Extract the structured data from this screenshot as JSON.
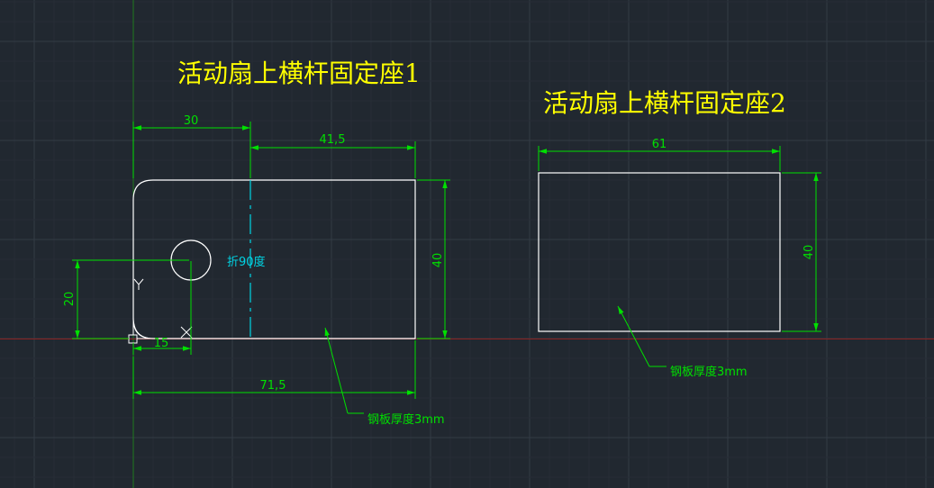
{
  "drawing": {
    "colors": {
      "background": "#212830",
      "grid_minor": "#262d36",
      "grid_major": "#333b45",
      "geometry": "#ffffff",
      "dimension": "#00e000",
      "title": "#ffff00",
      "fold_line": "#00d5e5",
      "axis_y": "#1e7a1e",
      "axis_x": "#8a2222"
    },
    "part1": {
      "title": "活动扇上横杆固定座1",
      "dim_top_left": "30",
      "dim_top_right": "41,5",
      "dim_right_height": "40",
      "dim_left_height": "20",
      "dim_hole_offset": "15",
      "dim_bottom_width": "71,5",
      "fold_note": "折90度",
      "thickness_note": "钢板厚度3mm",
      "ucs_y": "Y",
      "ucs_x": "X"
    },
    "part2": {
      "title": "活动扇上横杆固定座2",
      "dim_width": "61",
      "dim_height": "40",
      "thickness_note": "钢板厚度3mm"
    }
  }
}
